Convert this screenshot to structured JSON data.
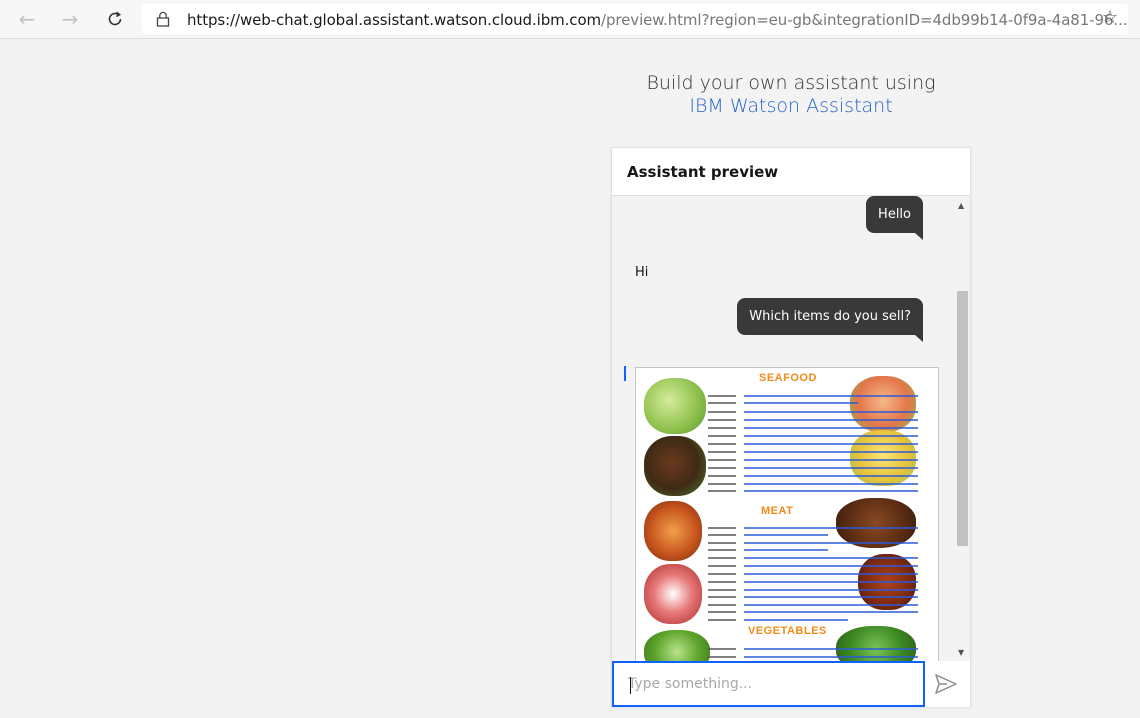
{
  "browser": {
    "url_host": "https://web-chat.global.assistant.watson.cloud.ibm.com",
    "url_rest": "/preview.html?region=eu-gb&integrationID=4db99b14-0f9a-4a81-96..."
  },
  "page": {
    "build_line": "Build your own assistant using",
    "build_link": "IBM Watson Assistant"
  },
  "chat": {
    "header_title": "Assistant preview",
    "messages": [
      {
        "from": "user",
        "text": "Hello"
      },
      {
        "from": "bot",
        "text": "Hi"
      },
      {
        "from": "user",
        "text": "Which items do you sell?"
      }
    ],
    "menu_sections": [
      "SEAFOOD",
      "MEAT",
      "VEGETABLES"
    ],
    "input_placeholder": "Type something..."
  },
  "colors": {
    "accent": "#0f62fe",
    "link": "#2563c9",
    "user_bubble": "#393939",
    "menu_heading": "#f08b18"
  },
  "icons": [
    "back-arrow-icon",
    "forward-arrow-icon",
    "refresh-icon",
    "lock-icon",
    "star-icon",
    "send-icon"
  ]
}
